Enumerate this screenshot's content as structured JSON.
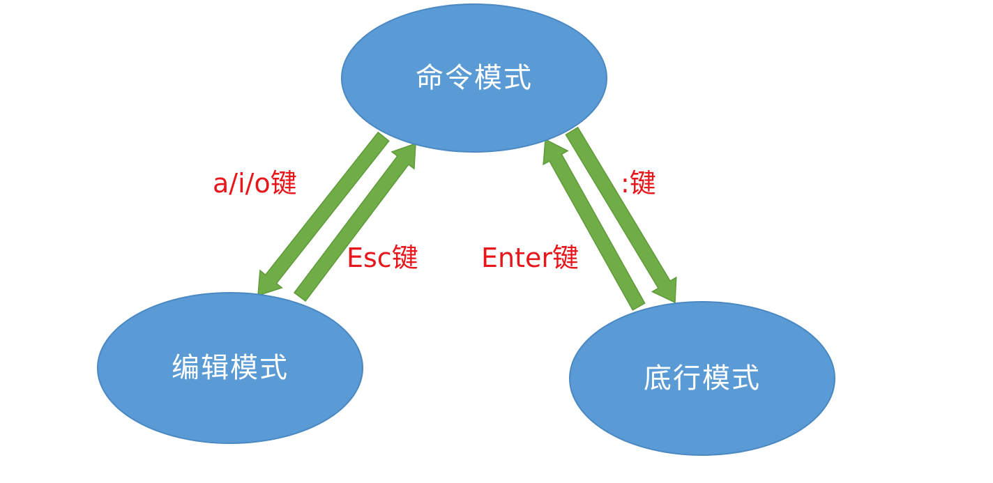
{
  "colors": {
    "node_fill": "#5B9BD5",
    "node_stroke": "#4A88C2",
    "node_text": "#ffffff",
    "arrow_fill": "#70AD47",
    "arrow_stroke": "#5E9A3A",
    "label_text": "#E8161B"
  },
  "nodes": {
    "command": {
      "label": "命令模式"
    },
    "edit": {
      "label": "编辑模式"
    },
    "bottom": {
      "label": "底行模式"
    }
  },
  "edges": [
    {
      "from": "command",
      "to": "edit",
      "label": "a/i/o键"
    },
    {
      "from": "edit",
      "to": "command",
      "label": "Esc键"
    },
    {
      "from": "bottom",
      "to": "command",
      "label": "Enter键"
    },
    {
      "from": "command",
      "to": "bottom",
      "label": ":键"
    }
  ]
}
